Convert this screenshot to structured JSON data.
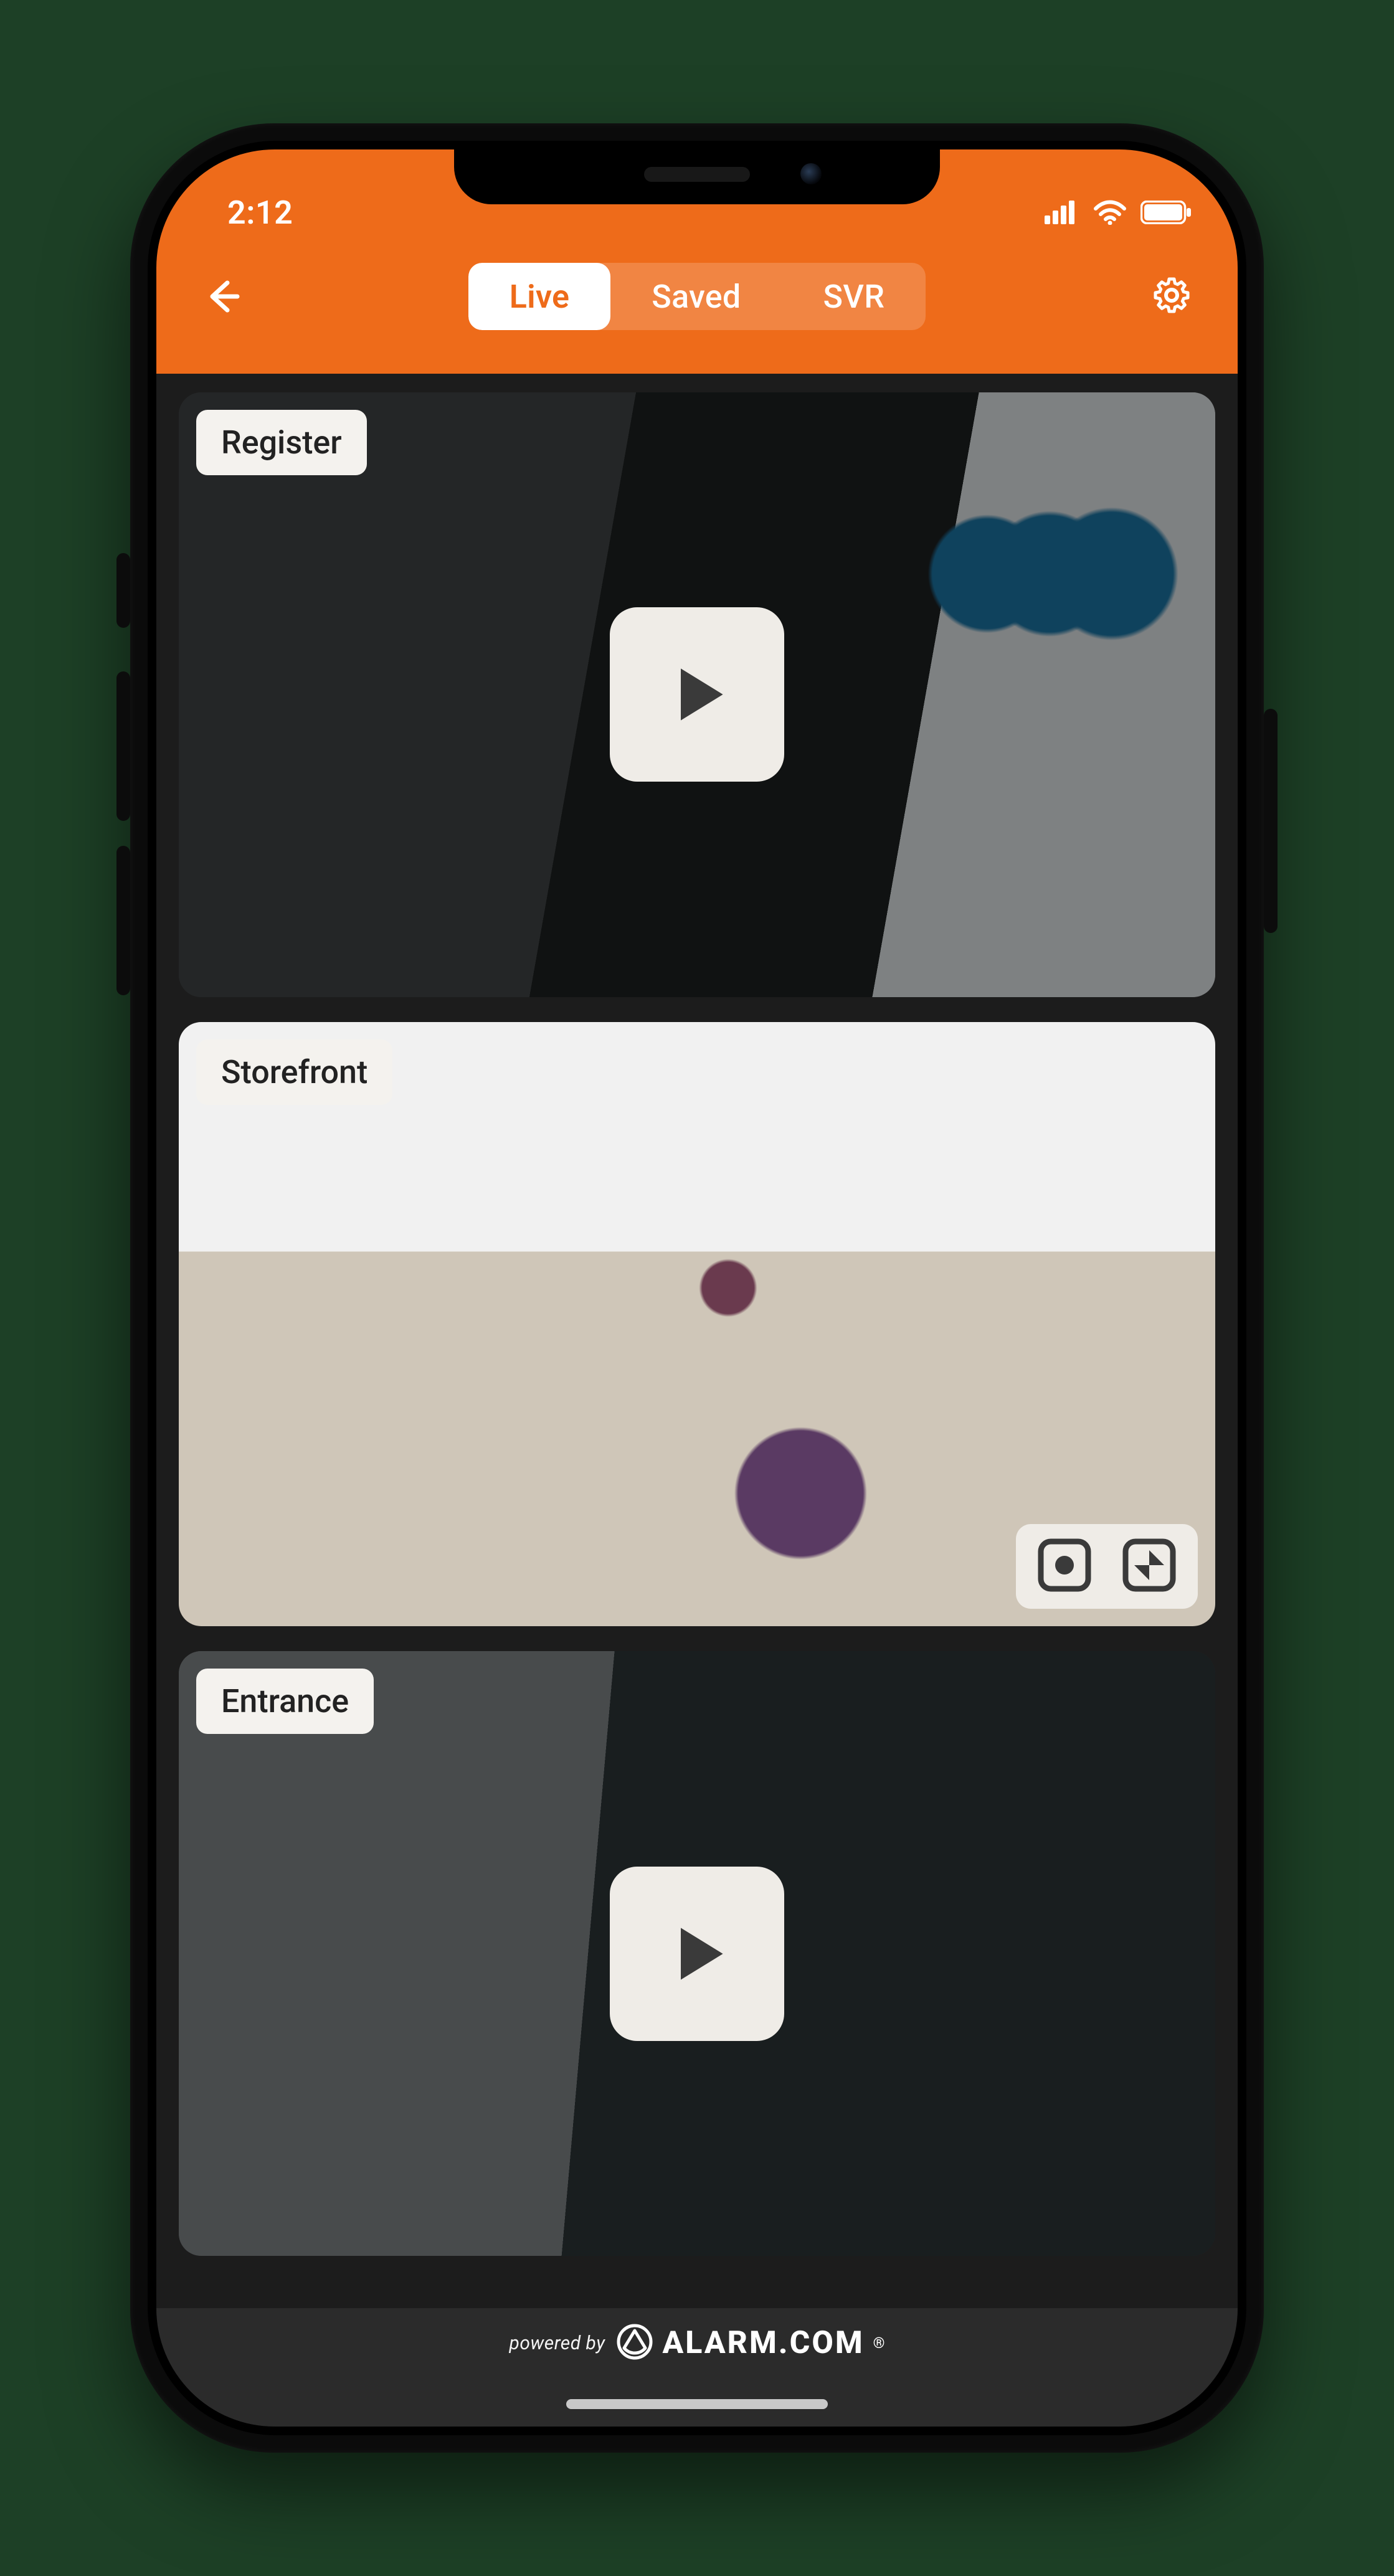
{
  "status_bar": {
    "time": "2:12"
  },
  "header": {
    "tabs": [
      {
        "label": "Live",
        "active": true
      },
      {
        "label": "Saved",
        "active": false
      },
      {
        "label": "SVR",
        "active": false
      }
    ]
  },
  "cameras": [
    {
      "label": "Register",
      "playing": false,
      "show_tools": false
    },
    {
      "label": "Storefront",
      "playing": true,
      "show_tools": true
    },
    {
      "label": "Entrance",
      "playing": false,
      "show_tools": false
    }
  ],
  "footer": {
    "powered_by": "powered by",
    "brand": "ALARM.COM"
  },
  "colors": {
    "accent": "#ee6b1a"
  }
}
